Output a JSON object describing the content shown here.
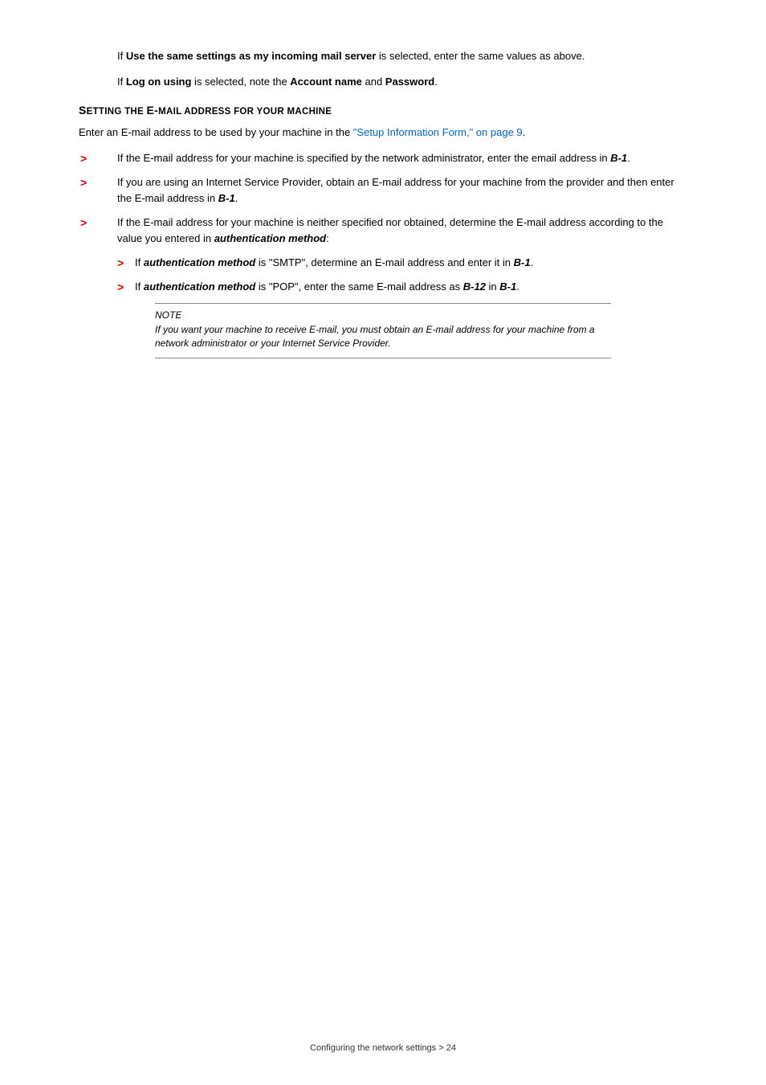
{
  "intro": {
    "p1_a": "If ",
    "p1_b": "Use the same settings as my incoming mail server",
    "p1_c": " is selected, enter the same values as above.",
    "p2_a": "If ",
    "p2_b": "Log on using",
    "p2_c": " is selected, note the ",
    "p2_d": "Account name",
    "p2_e": " and ",
    "p2_f": "Password",
    "p2_g": "."
  },
  "heading": {
    "a": "S",
    "b": "ETTING THE ",
    "c": "E-",
    "d": "MAIL ADDRESS FOR YOUR MACHINE"
  },
  "lead": {
    "a": "Enter an E-mail address to be used by your machine in the ",
    "link": "\"Setup Information Form,\" on page 9",
    "b": "."
  },
  "bullets": {
    "b1_a": "If the E-mail address for your machine is specified by the network administrator, enter the email address in ",
    "b1_b": "B-1",
    "b1_c": ".",
    "b2_a": "If you are using an Internet Service Provider, obtain an E-mail address for your machine from the provider and then enter the E-mail address in ",
    "b2_b": "B-1",
    "b2_c": ".",
    "b3_a": "If the E-mail address for your machine is neither specified nor obtained, determine the E-mail address according to the value you entered in ",
    "b3_b": "authentication method",
    "b3_c": ":",
    "sub1_a": "If ",
    "sub1_b": "authentication method",
    "sub1_c": " is \"SMTP\", determine an E-mail address and enter it in ",
    "sub1_d": "B-1",
    "sub1_e": ".",
    "sub2_a": "If ",
    "sub2_b": "authentication method",
    "sub2_c": " is \"POP\", enter the same E-mail address as ",
    "sub2_d": "B-12",
    "sub2_e": " in ",
    "sub2_f": "B-1",
    "sub2_g": "."
  },
  "note": {
    "title": "NOTE",
    "body": "If you want your machine to receive E-mail, you must obtain an E-mail address for your machine from a network administrator or your Internet Service Provider."
  },
  "footer": "Configuring the network settings > 24"
}
